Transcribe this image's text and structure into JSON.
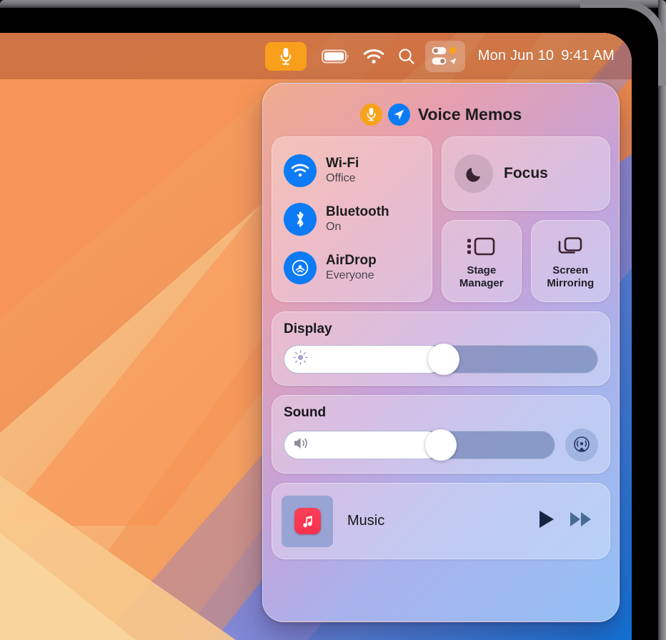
{
  "menubar": {
    "items": [
      {
        "name": "microphone-indicator",
        "icon": "microphone-icon",
        "label": "Microphone in use"
      },
      {
        "name": "battery",
        "icon": "battery-icon",
        "label": "Battery"
      },
      {
        "name": "wifi",
        "icon": "wifi-icon",
        "label": "Wi-Fi"
      },
      {
        "name": "spotlight",
        "icon": "search-icon",
        "label": "Spotlight Search"
      },
      {
        "name": "control-center",
        "icon": "control-center-icon",
        "label": "Control Center"
      }
    ],
    "date": "Mon Jun 10",
    "time": "9:41 AM"
  },
  "control_center": {
    "header": {
      "title": "Voice Memos",
      "mic_icon": "microphone-icon",
      "location_icon": "location-arrow-icon"
    },
    "connectivity": {
      "items": [
        {
          "label": "Wi-Fi",
          "status": "Office",
          "icon": "wifi-icon"
        },
        {
          "label": "Bluetooth",
          "status": "On",
          "icon": "bluetooth-icon"
        },
        {
          "label": "AirDrop",
          "status": "Everyone",
          "icon": "airdrop-icon"
        }
      ]
    },
    "focus": {
      "label": "Focus",
      "icon": "moon-icon"
    },
    "mini_tiles": [
      {
        "label": "Stage\nManager",
        "line1": "Stage",
        "line2": "Manager",
        "icon": "stage-manager-icon"
      },
      {
        "label": "Screen\nMirroring",
        "line1": "Screen",
        "line2": "Mirroring",
        "icon": "screen-mirroring-icon"
      }
    ],
    "display": {
      "title": "Display",
      "icon": "brightness-icon",
      "value": 51
    },
    "sound": {
      "title": "Sound",
      "icon": "speaker-wave-icon",
      "value": 58,
      "airplay_icon": "airplay-audio-icon"
    },
    "music": {
      "title": "Music",
      "album_icon": "music-note-icon",
      "play_icon": "play-icon",
      "forward_icon": "fast-forward-icon"
    }
  },
  "colors": {
    "accent_blue": "#0C7BF5",
    "mic_orange": "#F7A31B",
    "music_red": "#FC4159"
  }
}
